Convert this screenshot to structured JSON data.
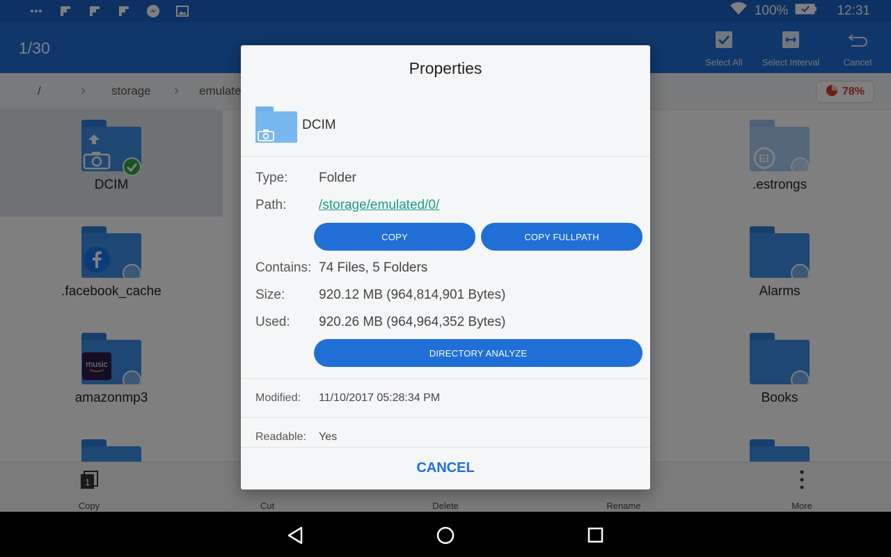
{
  "status_bar": {
    "icons": [
      "more-icon",
      "flipboard-icon",
      "flipboard-icon",
      "flipboard-icon",
      "messenger-icon",
      "gallery-icon"
    ],
    "battery_text": "100%",
    "time": "12:31"
  },
  "app_bar": {
    "counter": "1/30",
    "actions": [
      "Select All",
      "Select Interval",
      "Cancel"
    ]
  },
  "breadcrumb": {
    "items": [
      "/",
      "storage",
      "emulated"
    ],
    "usage": "78%"
  },
  "files": [
    {
      "name": "DCIM",
      "selected": true
    },
    {
      "name": ".estrongs",
      "selected": false
    },
    {
      "name": ".facebook_cache",
      "selected": false
    },
    {
      "name": "Alarms",
      "selected": false
    },
    {
      "name": "amazonmp3",
      "selected": false,
      "badge_text": "music"
    },
    {
      "name": "Books",
      "selected": false
    }
  ],
  "toolbar": {
    "copy": "Copy",
    "copy_count": "1",
    "cut": "Cut",
    "delete": "Delete",
    "rename": "Rename",
    "more": "More"
  },
  "dialog": {
    "title": "Properties",
    "folder_name": "DCIM",
    "type_label": "Type:",
    "type_value": "Folder",
    "path_label": "Path:",
    "path_value": "/storage/emulated/0/",
    "copy_button": "COPY",
    "copy_fullpath_button": "COPY FULLPATH",
    "contains_label": "Contains:",
    "contains_value": "74 Files, 5 Folders",
    "size_label": "Size:",
    "size_value": "920.12 MB (964,814,901 Bytes)",
    "used_label": "Used:",
    "used_value": "920.26 MB (964,964,352 Bytes)",
    "directory_analyze_button": "DIRECTORY ANALYZE",
    "modified_label": "Modified:",
    "modified_value": "11/10/2017 05:28:34 PM",
    "readable_label": "Readable:",
    "readable_value": "Yes",
    "cancel_button": "CANCEL"
  },
  "colors": {
    "primary": "#1f6fd6",
    "status_bar": "#1a63c7",
    "link": "#1a9e83",
    "usage_badge": "#d63a2f",
    "check_on": "#2fa84f"
  }
}
